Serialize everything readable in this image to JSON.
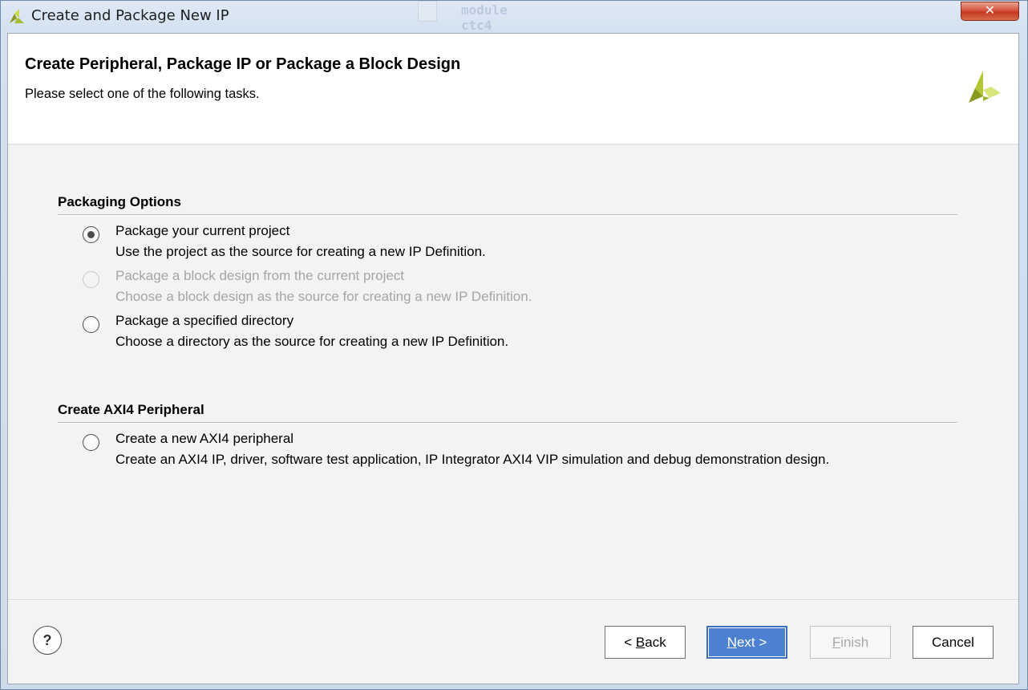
{
  "window": {
    "title": "Create and Package New IP",
    "close_glyph": "✕",
    "background_code": "module ctc4"
  },
  "header": {
    "title": "Create Peripheral, Package IP or Package a Block Design",
    "subtitle": "Please select one of the following tasks.",
    "logo_icon": "brand-logo-icon"
  },
  "sections": {
    "packaging": {
      "title": "Packaging Options",
      "options": [
        {
          "label": "Package your current project",
          "description": "Use the project as the source for creating a new IP Definition.",
          "selected": true,
          "enabled": true
        },
        {
          "label": "Package a block design from the current project",
          "description": "Choose a block design as the source for creating a new IP Definition.",
          "selected": false,
          "enabled": false
        },
        {
          "label": "Package a specified directory",
          "description": "Choose a directory as the source for creating a new IP Definition.",
          "selected": false,
          "enabled": true
        }
      ]
    },
    "axi": {
      "title": "Create AXI4 Peripheral",
      "options": [
        {
          "label": "Create a new AXI4 peripheral",
          "description": "Create an AXI4 IP, driver, software test application, IP Integrator AXI4 VIP simulation and debug demonstration design.",
          "selected": false,
          "enabled": true
        }
      ]
    }
  },
  "footer": {
    "help_label": "?",
    "back": {
      "prefix": "< ",
      "mnemonic": "B",
      "rest": "ack"
    },
    "next": {
      "mnemonic": "N",
      "rest": "ext >"
    },
    "finish": {
      "mnemonic": "F",
      "rest": "inish",
      "enabled": false
    },
    "cancel": "Cancel"
  },
  "colors": {
    "accent": "#4d80d0",
    "brand_light": "#c6d84a",
    "brand_dark": "#7c8c1e"
  }
}
